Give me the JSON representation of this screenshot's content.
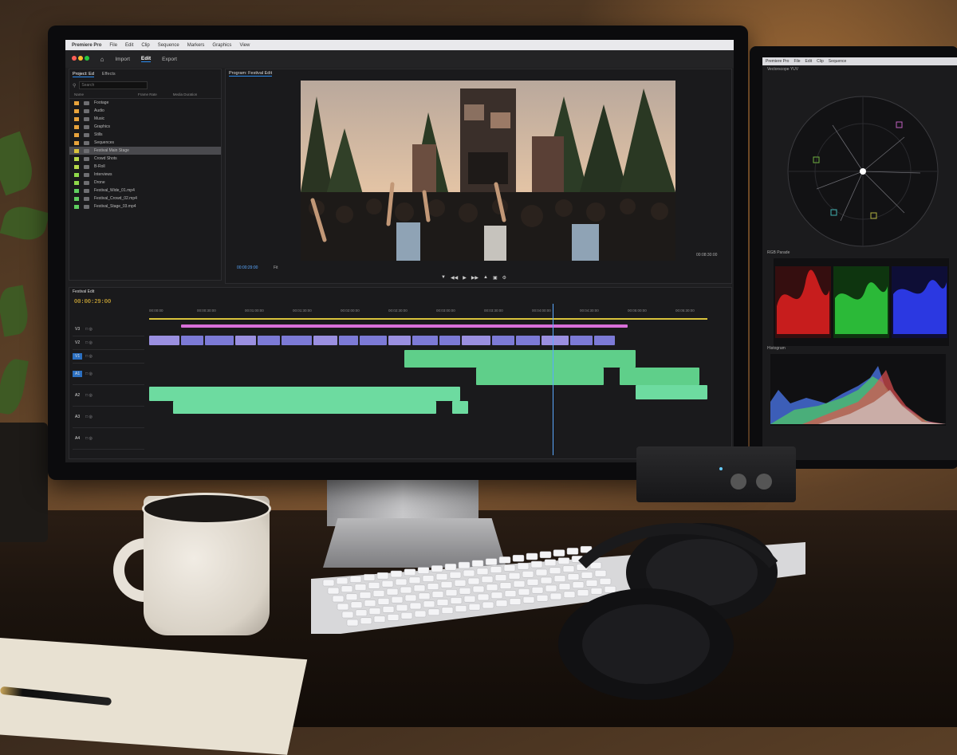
{
  "app": {
    "name": "Premiere Pro",
    "menu": [
      "Premiere Pro",
      "File",
      "Edit",
      "Clip",
      "Sequence",
      "Markers",
      "Graphics",
      "View"
    ],
    "workspaces": [
      "Import",
      "Edit",
      "Export"
    ],
    "active_workspace": "Edit"
  },
  "project_panel": {
    "tabs": [
      "Project: Ed",
      "Effects"
    ],
    "search_placeholder": "Search",
    "column_headers": [
      "Name",
      "Frame Rate",
      "Media Duration"
    ],
    "items": [
      {
        "label": "Footage",
        "color": "#e8a33b",
        "selected": false
      },
      {
        "label": "Audio",
        "color": "#e8a33b",
        "selected": false
      },
      {
        "label": "Music",
        "color": "#e8a33b",
        "selected": false
      },
      {
        "label": "Graphics",
        "color": "#e8a33b",
        "selected": false
      },
      {
        "label": "Stills",
        "color": "#e8a33b",
        "selected": false
      },
      {
        "label": "Sequences",
        "color": "#e8a33b",
        "selected": false
      },
      {
        "label": "Festival Main Stage",
        "color": "#d9c23b",
        "selected": true
      },
      {
        "label": "Crowd Shots",
        "color": "#b8d94a",
        "selected": false
      },
      {
        "label": "B-Roll",
        "color": "#b8d94a",
        "selected": false
      },
      {
        "label": "Interviews",
        "color": "#8fd94a",
        "selected": false
      },
      {
        "label": "Drone",
        "color": "#8fd94a",
        "selected": false
      },
      {
        "label": "Festival_Wide_01.mp4",
        "color": "#5fcf5f",
        "selected": false
      },
      {
        "label": "Festival_Crowd_02.mp4",
        "color": "#5fcf5f",
        "selected": false
      },
      {
        "label": "Festival_Stage_03.mp4",
        "color": "#5fcf5f",
        "selected": false
      }
    ]
  },
  "program_monitor": {
    "tab": "Program: Festival Edit",
    "timecode_left": "00:00:29:00",
    "fit": "Fit",
    "timecode_right": "00:08:30:00"
  },
  "timeline": {
    "tab": "Festival Edit",
    "timecode": "00:00:29:00",
    "ruler": [
      "00:00:00",
      "00:00:30:00",
      "00:01:00:00",
      "00:01:30:00",
      "00:02:00:00",
      "00:02:30:00",
      "00:03:00:00",
      "00:03:30:00",
      "00:04:00:00",
      "00:04:30:00",
      "00:05:00:00",
      "00:05:30:00"
    ],
    "tracks": [
      "V3",
      "V2",
      "V1",
      "A1",
      "A2",
      "A3",
      "A4"
    ]
  },
  "scopes": {
    "titlebar": [
      "Premiere Pro",
      "File",
      "Edit",
      "Clip",
      "Sequence"
    ],
    "vectorscope_label": "Vectorscope YUV",
    "parade_label": "RGB Parade",
    "histogram_label": "Histogram"
  },
  "colors": {
    "accent_blue": "#2b8cf0",
    "playhead": "#5aa8ff",
    "video_clip": "#7c7ad6",
    "audio_clip": "#5fcf8a",
    "adjustment": "#d86fd8"
  }
}
